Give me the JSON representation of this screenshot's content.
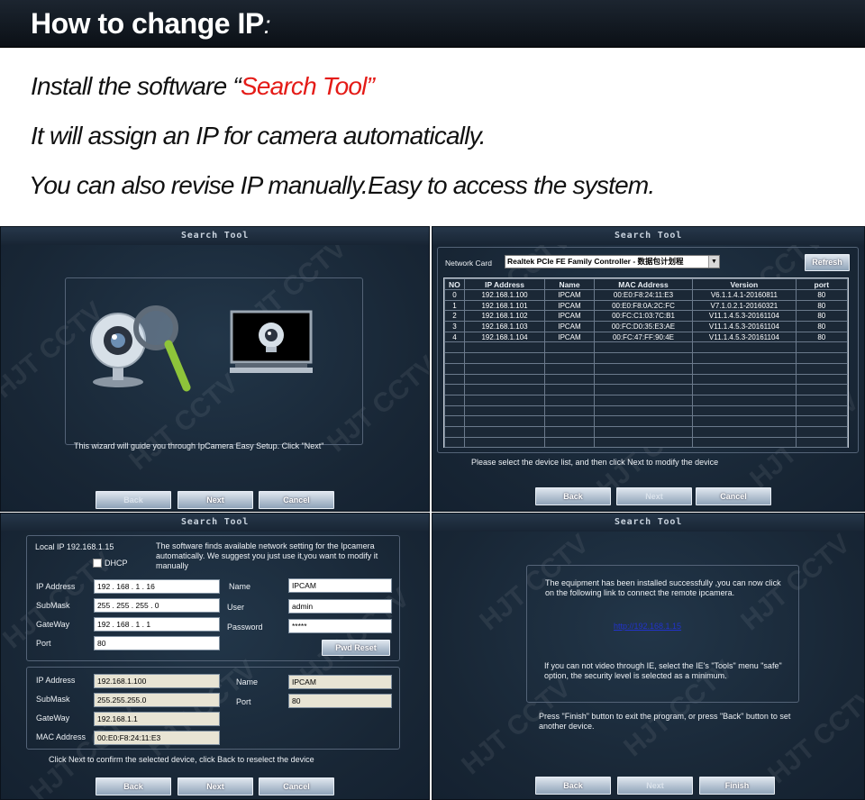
{
  "header": {
    "title": "How to change  IP",
    "colon": ":"
  },
  "intro": {
    "line1_prefix": "Install the software “",
    "line1_highlight": "Search Tool",
    "line1_suffix": "”",
    "line2": "It will assign an IP for camera automatically.",
    "line3": "You can also revise IP manually.Easy to access the system."
  },
  "colors": {
    "accent": "#e41b17",
    "panel_bg": "#1a2a3b"
  },
  "watermark": "HJT CCTV",
  "panel1": {
    "title": "Search Tool",
    "wizard_text": "This wizard will guide you through IpCamera Easy Setup. Click \"Next\"",
    "buttons": {
      "back": "Back",
      "next": "Next",
      "cancel": "Cancel"
    }
  },
  "panel2": {
    "title": "Search Tool",
    "network_card_label": "Network Card",
    "network_card_value": "Realtek PCIe FE Family Controller - 数据包计划程",
    "refresh": "Refresh",
    "columns": [
      "NO",
      "IP Address",
      "Name",
      "MAC Address",
      "Version",
      "port"
    ],
    "rows": [
      [
        "0",
        "192.168.1.100",
        "IPCAM",
        "00:E0:F8:24:11:E3",
        "V6.1.1.4.1-20160811",
        "80"
      ],
      [
        "1",
        "192.168.1.101",
        "IPCAM",
        "00:E0:F8:0A:2C:FC",
        "V7.1.0.2.1-20160321",
        "80"
      ],
      [
        "2",
        "192.168.1.102",
        "IPCAM",
        "00:FC:C1:03:7C:B1",
        "V11.1.4.5.3-20161104",
        "80"
      ],
      [
        "3",
        "192.168.1.103",
        "IPCAM",
        "00:FC:D0:35:E3:AE",
        "V11.1.4.5.3-20161104",
        "80"
      ],
      [
        "4",
        "192.168.1.104",
        "IPCAM",
        "00:FC:47:FF:90:4E",
        "V11.1.4.5.3-20161104",
        "80"
      ]
    ],
    "hint": "Please select the device list, and then click Next to modify the device",
    "buttons": {
      "back": "Back",
      "next": "Next",
      "cancel": "Cancel"
    }
  },
  "panel3": {
    "title": "Search Tool",
    "local_ip": "Local IP 192.168.1.15",
    "dhcp": "DHCP",
    "info": "The software finds available network setting for the Ipcamera automatically. We suggest you just use it,you want to modify it manually",
    "ip_label": "IP Address",
    "ip_value": " 192  .  168  .  1  .  16",
    "mask_label": "SubMask",
    "mask_value": " 255  .  255  .  255  .  0",
    "gw_label": "GateWay",
    "gw_value": " 192  .  168  .  1  .  1",
    "port_label": "Port",
    "port_value": "80",
    "name_label": "Name",
    "name_value": "IPCAM",
    "user_label": "User",
    "user_value": "admin",
    "pass_label": "Password",
    "pass_value": "*****",
    "pwd_reset": "Pwd Reset",
    "ro_ip_label": "IP Address",
    "ro_ip": "192.168.1.100",
    "ro_mask_label": "SubMask",
    "ro_mask": "255.255.255.0",
    "ro_gw_label": "GateWay",
    "ro_gw": "192.168.1.1",
    "ro_mac_label": "MAC Address",
    "ro_mac": "00:E0:F8:24:11:E3",
    "ro_name_label": "Name",
    "ro_name": "IPCAM",
    "ro_port_label": "Port",
    "ro_port": "80",
    "hint": "Click Next to confirm the selected device, click Back to reselect the device",
    "buttons": {
      "back": "Back",
      "next": "Next",
      "cancel": "Cancel"
    }
  },
  "panel4": {
    "title": "Search Tool",
    "success": "The equipment has been installed successfully ,you can now click on the following link to connect the remote ipcamera.",
    "link": "http://192.168.1.15",
    "ie_note": "If you can not video through IE, select the IE's \"Tools\" menu  \"safe\" option, the security level is selected as a minimum.",
    "finish_note": "Press \"Finish\" button to exit the program, or press \"Back\" button to set another device.",
    "buttons": {
      "back": "Back",
      "next": "Next",
      "finish": "Finish"
    }
  }
}
